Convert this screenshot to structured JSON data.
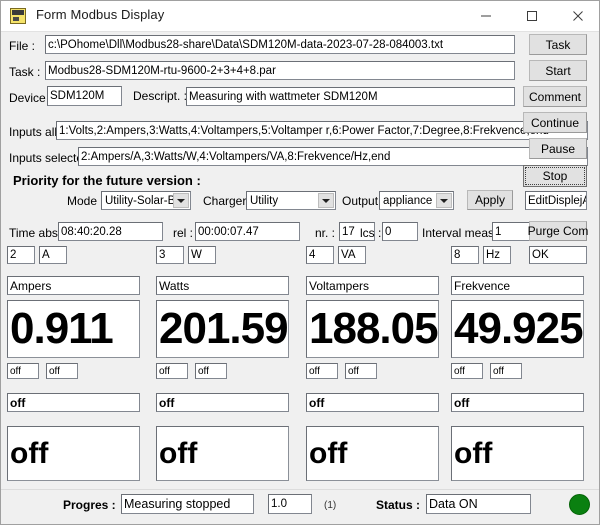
{
  "window": {
    "title": "Form Modbus Display",
    "icon": "form-modbus-icon",
    "minimize": "—",
    "maximize": "□",
    "close": "✕"
  },
  "form": {
    "file_label": "File :",
    "file_value": "c:\\POhome\\Dll\\Modbus28-share\\Data\\SDM120M-data-2023-07-28-084003.txt",
    "task_label": "Task :",
    "task_value": "Modbus28-SDM120M-rtu-9600-2+3+4+8.par",
    "device_label": "Device :",
    "device_value": "SDM120M",
    "descript_label": "Descript. :",
    "descript_value": "Measuring with wattmeter SDM120M",
    "inputs_all_label": "Inputs all :",
    "inputs_all_value": "1:Volts,2:Ampers,3:Watts,4:Voltampers,5:Voltamper r,6:Power Factor,7:Degree,8:Frekvence,end",
    "inputs_selected_label": "Inputs selected :",
    "inputs_selected_value": "2:Ampers/A,3:Watts/W,4:Voltampers/VA,8:Frekvence/Hz,end"
  },
  "buttons": {
    "task": "Task",
    "start": "Start",
    "comment": "Comment",
    "continue": "Continue",
    "pause": "Pause",
    "stop": "Stop",
    "apply": "Apply",
    "purge_com": "Purge Com",
    "edit_display": "EditDisplejAp"
  },
  "priority": {
    "heading": "Priority for the future version  :",
    "mode_label": "Mode :",
    "mode_value": "Utility-Solar-Bat",
    "charger_label": "Charger :",
    "charger_value": "Utility",
    "output_label": "Output :",
    "output_value": "appliance"
  },
  "timing": {
    "time_abs_label": "Time abs :",
    "time_abs_value": "08:40:20.28",
    "rel_label": "rel :",
    "rel_value": "00:00:07.47",
    "nr_label": "nr. :",
    "nr_value": "17",
    "lcs_label": "lcs :",
    "lcs_value": "0",
    "interval_label": "Interval meas. :",
    "interval_value": "1",
    "com_status": "OK"
  },
  "channels": [
    {
      "index": "2",
      "unit": "A",
      "name": "Ampers",
      "value": "0.911",
      "flag_a": "off",
      "flag_b": "off",
      "sub_text": "off",
      "sub_big": "off"
    },
    {
      "index": "3",
      "unit": "W",
      "name": "Watts",
      "value": "201.59",
      "flag_a": "off",
      "flag_b": "off",
      "sub_text": "off",
      "sub_big": "off"
    },
    {
      "index": "4",
      "unit": "VA",
      "name": "Voltampers",
      "value": "188.05",
      "flag_a": "off",
      "flag_b": "off",
      "sub_text": "off",
      "sub_big": "off"
    },
    {
      "index": "8",
      "unit": "Hz",
      "name": "Frekvence",
      "value": "49.925",
      "flag_a": "off",
      "flag_b": "off",
      "sub_text": "off",
      "sub_big": "off"
    }
  ],
  "statusbar": {
    "progres_label": "Progres :",
    "progres_value": "Measuring stopped",
    "progres_num": "1.0",
    "progres_count": "(1)",
    "status_label": "Status :",
    "status_value": "Data ON",
    "led_color": "#0a8010"
  }
}
